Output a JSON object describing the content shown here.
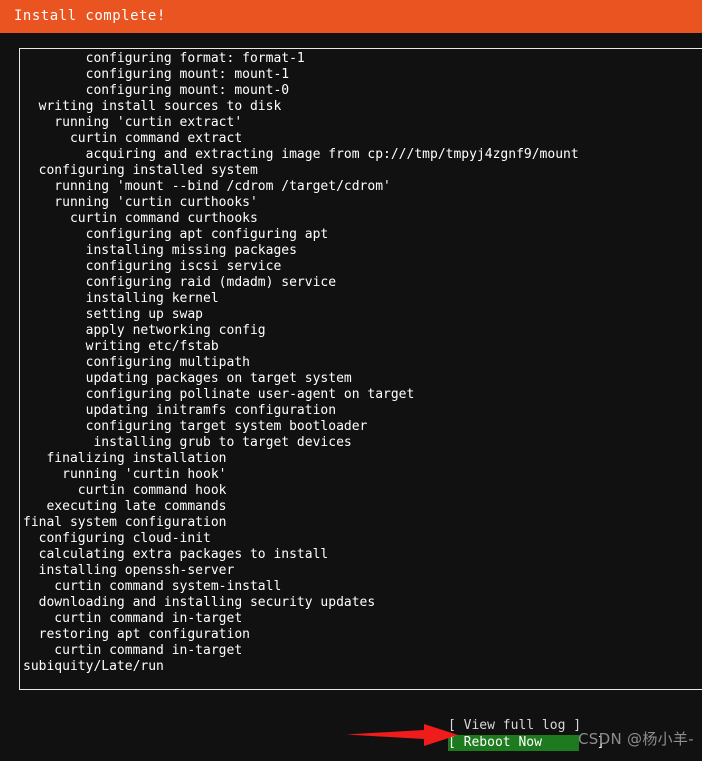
{
  "window": {
    "title": "Install complete!",
    "accent_color": "#e95420",
    "background_color": "#111111",
    "text_color": "#ffffff"
  },
  "log": {
    "border_color": "#e8e8e8",
    "lines": [
      "        configuring format: format-1",
      "        configuring mount: mount-1",
      "        configuring mount: mount-0",
      "  writing install sources to disk",
      "    running 'curtin extract'",
      "      curtin command extract",
      "        acquiring and extracting image from cp:///tmp/tmpyj4zgnf9/mount",
      "  configuring installed system",
      "    running 'mount --bind /cdrom /target/cdrom'",
      "    running 'curtin curthooks'",
      "      curtin command curthooks",
      "        configuring apt configuring apt",
      "        installing missing packages",
      "        configuring iscsi service",
      "        configuring raid (mdadm) service",
      "        installing kernel",
      "        setting up swap",
      "        apply networking config",
      "        writing etc/fstab",
      "        configuring multipath",
      "        updating packages on target system",
      "        configuring pollinate user-agent on target",
      "        updating initramfs configuration",
      "        configuring target system bootloader",
      "         installing grub to target devices",
      "   finalizing installation",
      "     running 'curtin hook'",
      "       curtin command hook",
      "   executing late commands",
      "final system configuration",
      "  configuring cloud-init",
      "  calculating extra packages to install",
      "  installing openssh-server",
      "    curtin command system-install",
      "  downloading and installing security updates",
      "    curtin command in-target",
      "  restoring apt configuration",
      "    curtin command in-target",
      "subiquity/Late/run"
    ]
  },
  "buttons": {
    "view_full_log": "[ View full log ]",
    "reboot_now": "[ Reboot Now       ]",
    "reboot_selected": true,
    "reboot_highlight_color": "#1e7a1e"
  },
  "annotation": {
    "arrow_color": "#f01c1c",
    "arrow_target": "reboot-now-button"
  },
  "watermark": {
    "text": "CSDN @杨小羊-",
    "color": "#8b8f8b"
  }
}
